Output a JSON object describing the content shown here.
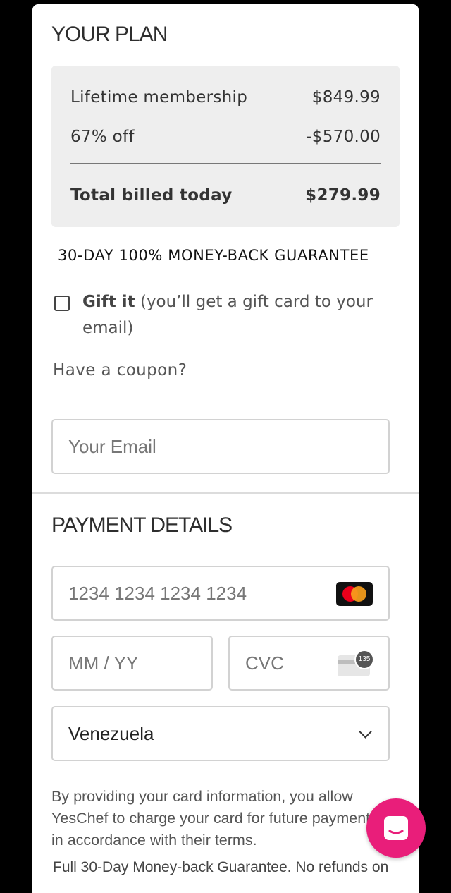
{
  "plan": {
    "title": "YOUR PLAN",
    "membership_label": "Lifetime membership",
    "membership_price": "$849.99",
    "discount_label": "67% off",
    "discount_value": "-$570.00",
    "total_label": "Total billed today",
    "total_value": "$279.99"
  },
  "guarantee": "30-DAY 100% MONEY-BACK GUARANTEE",
  "gift": {
    "bold": "Gift it",
    "text": " (you’ll get a gift card to your email)",
    "checked": false
  },
  "coupon_link": "Have a coupon?",
  "email": {
    "placeholder": "Your Email",
    "value": ""
  },
  "payment": {
    "title": "PAYMENT DETAILS",
    "card_number_placeholder": "1234 1234 1234 1234",
    "expiry_placeholder": "MM / YY",
    "cvc_placeholder": "CVC",
    "cvc_badge": "135",
    "card_brand_icon": "mastercard-icon",
    "country": "Venezuela"
  },
  "terms": {
    "authorization": "By providing your card information, you allow YesChef to charge your card for future payments in accordance with their terms.",
    "guarantee_note": "Full 30-Day Money-back Guarantee. No refunds on"
  },
  "colors": {
    "accent": "#e91e7a",
    "plan_bg": "#eeeeee"
  }
}
